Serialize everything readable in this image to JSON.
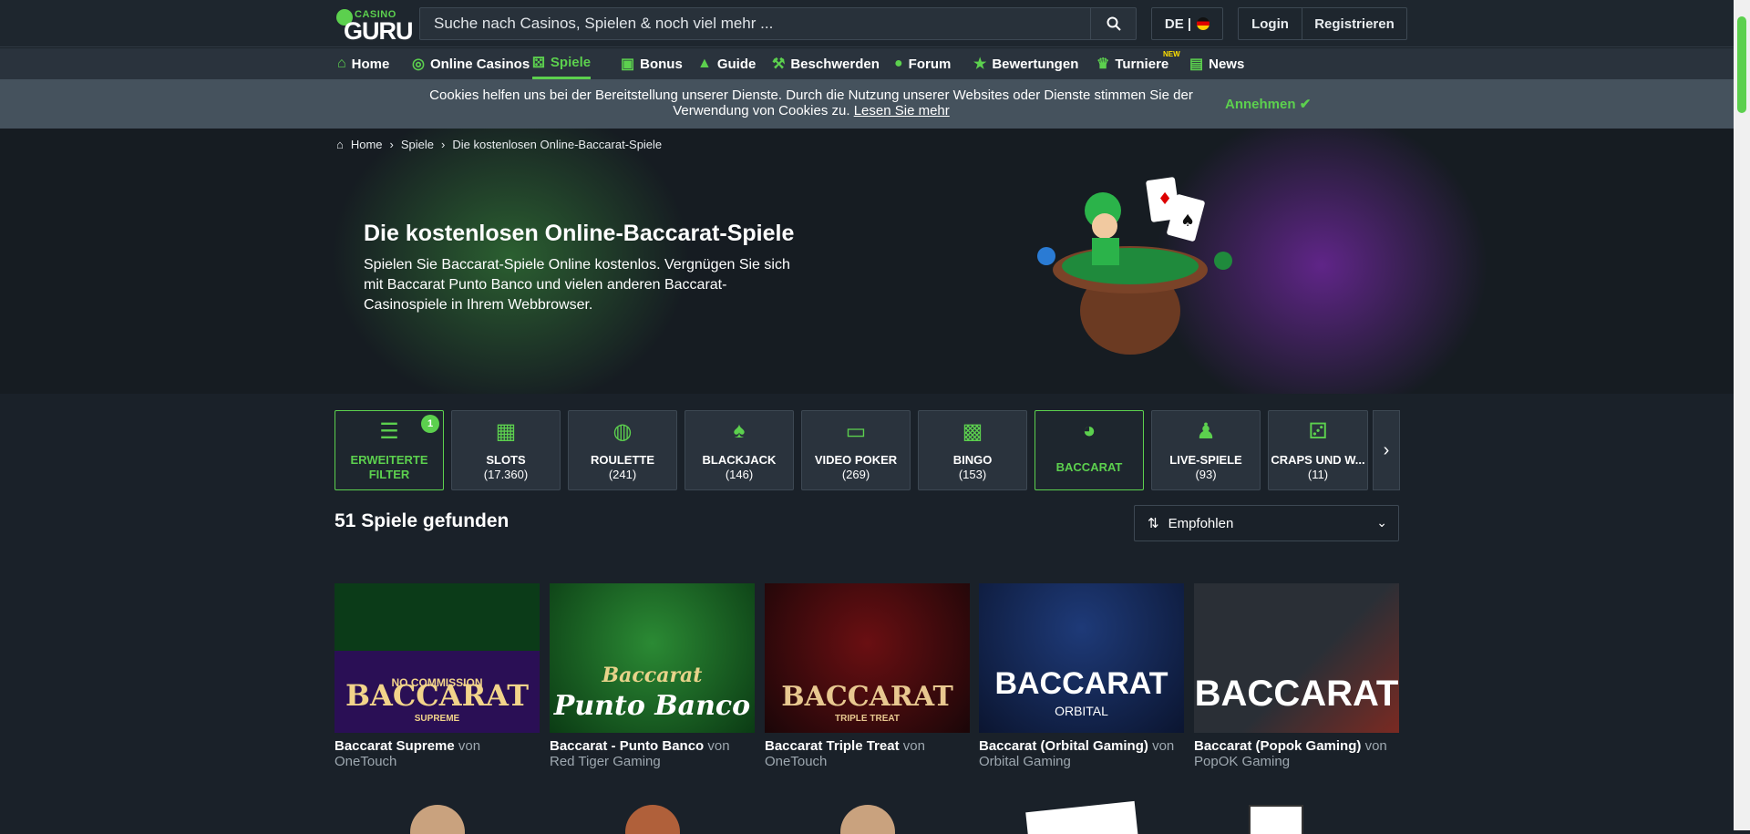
{
  "header": {
    "logo_top": "CASINO",
    "logo_main": "GURU",
    "search_placeholder": "Suche nach Casinos, Spielen & noch viel mehr ...",
    "lang": "DE |",
    "login": "Login",
    "register": "Registrieren"
  },
  "nav": {
    "items": [
      {
        "label": "Home",
        "icon": "home-icon"
      },
      {
        "label": "Online Casinos",
        "icon": "chip-icon"
      },
      {
        "label": "Spiele",
        "icon": "dice-icon"
      },
      {
        "label": "Bonus",
        "icon": "gift-icon"
      },
      {
        "label": "Guide",
        "icon": "graduation-cap-icon"
      },
      {
        "label": "Beschwerden",
        "icon": "gavel-icon"
      },
      {
        "label": "Forum",
        "icon": "users-icon"
      },
      {
        "label": "Bewertungen",
        "icon": "star-icon"
      },
      {
        "label": "Turniere",
        "icon": "trophy-icon"
      },
      {
        "label": "News",
        "icon": "newspaper-icon"
      }
    ],
    "new_badge": "NEW"
  },
  "cookie": {
    "text": "Cookies helfen uns bei der Bereitstellung unserer Dienste. Durch die Nutzung unserer Websites oder Dienste stimmen Sie der Verwendung von Cookies zu.",
    "link": "Lesen Sie mehr",
    "accept": "Annehmen"
  },
  "breadcrumb": [
    "Home",
    "Spiele",
    "Die kostenlosen Online-Baccarat-Spiele"
  ],
  "hero": {
    "title": "Die kostenlosen Online-Baccarat-Spiele",
    "text": "Spielen Sie Baccarat-Spiele Online kostenlos. Vergnügen Sie sich mit Baccarat Punto Banco und vielen anderen Baccarat-Casinospiele in Ihrem Webbrowser."
  },
  "filters": [
    {
      "label": "ERWEITERTE FILTER",
      "count": "",
      "badge": "1"
    },
    {
      "label": "SLOTS",
      "count": "(17.360)"
    },
    {
      "label": "ROULETTE",
      "count": "(241)"
    },
    {
      "label": "BLACKJACK",
      "count": "(146)"
    },
    {
      "label": "VIDEO POKER",
      "count": "(269)"
    },
    {
      "label": "BINGO",
      "count": "(153)"
    },
    {
      "label": "BACCARAT",
      "count": ""
    },
    {
      "label": "LIVE-SPIELE",
      "count": "(93)"
    },
    {
      "label": "CRAPS UND W...",
      "count": "(11)"
    }
  ],
  "results": "51 Spiele gefunden",
  "sort": "Empfohlen",
  "games": [
    {
      "title": "Baccarat Supreme",
      "by": "von",
      "provider": "OneTouch",
      "thumb_text": "BACCARAT",
      "thumb_sub": "NO COMMISSION",
      "thumb_sub2": "SUPREME"
    },
    {
      "title": "Baccarat - Punto Banco",
      "by": "von",
      "provider": "Red Tiger Gaming",
      "thumb_text": "Punto Banco",
      "thumb_sub": "Baccarat"
    },
    {
      "title": "Baccarat Triple Treat",
      "by": "von",
      "provider": "OneTouch",
      "thumb_text": "BACCARAT",
      "thumb_sub": "TRIPLE TREAT"
    },
    {
      "title": "Baccarat (Orbital Gaming)",
      "by": "von",
      "provider": "Orbital Gaming",
      "thumb_text": "BACCARAT",
      "thumb_sub": "ORBITAL"
    },
    {
      "title": "Baccarat (Popok Gaming)",
      "by": "von",
      "provider": "PopOK Gaming",
      "thumb_text": "BACCARAT"
    }
  ]
}
